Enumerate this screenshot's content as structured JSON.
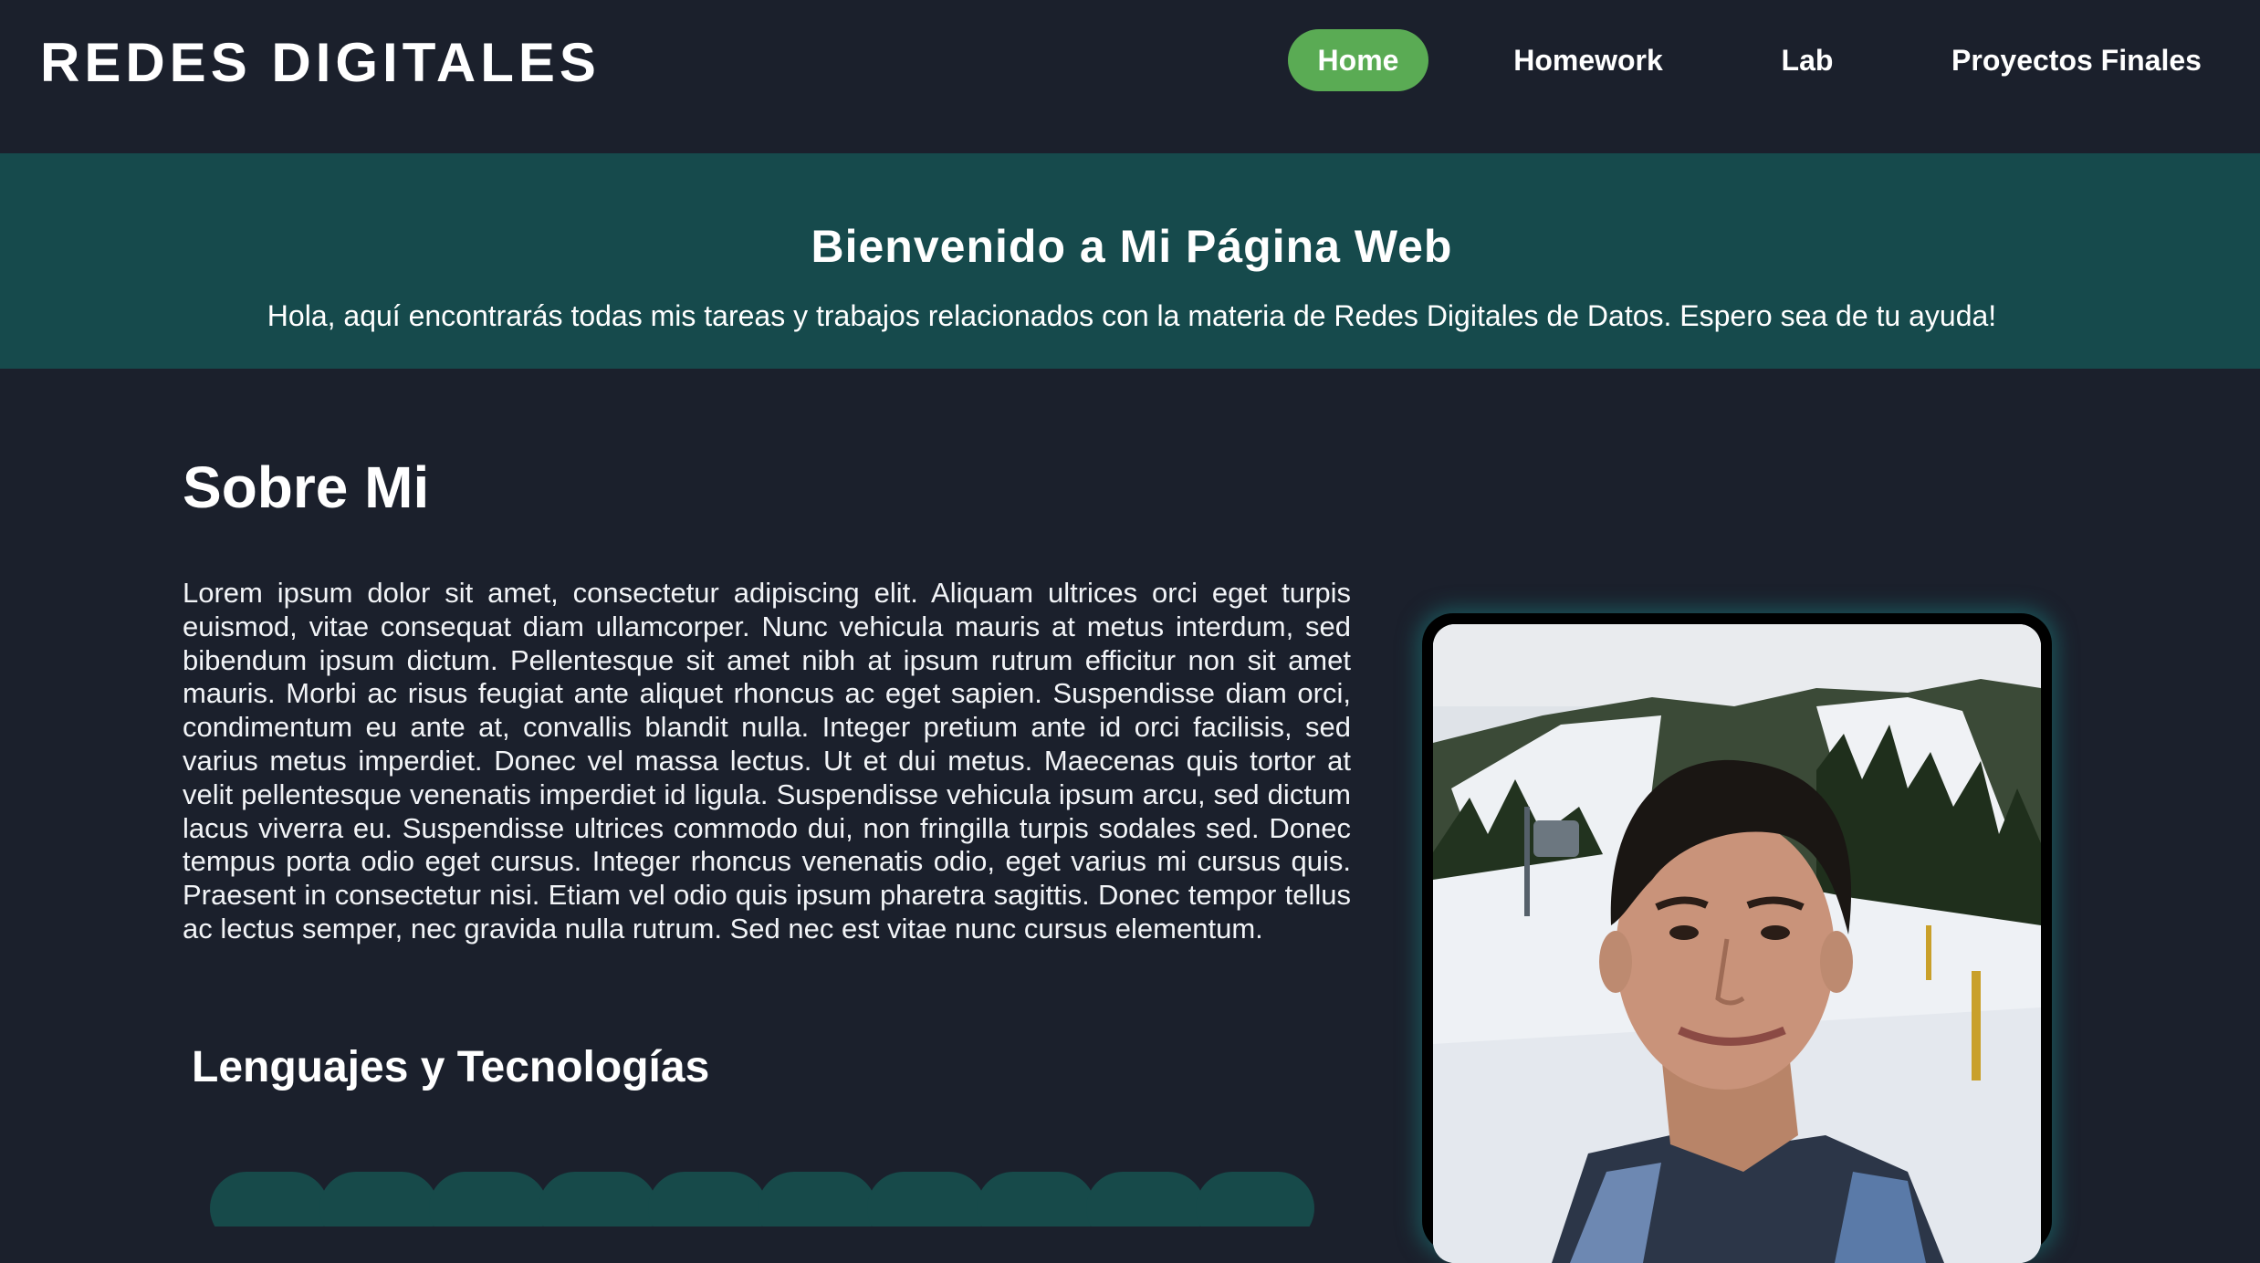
{
  "navbar": {
    "logo": "REDES DIGITALES",
    "links": [
      {
        "label": "Home",
        "active": true
      },
      {
        "label": "Homework",
        "active": false
      },
      {
        "label": "Lab",
        "active": false
      },
      {
        "label": "Proyectos Finales",
        "active": false
      }
    ]
  },
  "hero": {
    "title": "Bienvenido a Mi Página Web",
    "subtitle": "Hola, aquí encontrarás todas mis tareas y trabajos relacionados con la materia de Redes Digitales de Datos. Espero sea de tu ayuda!"
  },
  "about": {
    "title": "Sobre Mi",
    "text": "Lorem ipsum dolor sit amet, consectetur adipiscing elit. Aliquam ultrices orci eget turpis euismod, vitae consequat diam ullamcorper. Nunc vehicula mauris at metus interdum, sed bibendum ipsum dictum. Pellentesque sit amet nibh at ipsum rutrum efficitur non sit amet mauris. Morbi ac risus feugiat ante aliquet rhoncus ac eget sapien. Suspendisse diam orci, condimentum eu ante at, convallis blandit nulla. Integer pretium ante id orci facilisis, sed varius metus imperdiet. Donec vel massa lectus. Ut et dui metus. Maecenas quis tortor at velit pellentesque venenatis imperdiet id ligula. Suspendisse vehicula ipsum arcu, sed dictum lacus viverra eu. Suspendisse ultrices commodo dui, non fringilla turpis sodales sed. Donec tempus porta odio eget cursus. Integer rhoncus venenatis odio, eget varius mi cursus quis. Praesent in consectetur nisi. Etiam vel odio quis ipsum pharetra sagittis. Donec tempor tellus ac lectus semper, nec gravida nulla rutrum. Sed nec est vitae nunc cursus elementum.",
    "tech_title": "Lenguajes y Tecnologías"
  },
  "colors": {
    "page_background": "#1b202c",
    "hero_background": "#164a4c",
    "active_nav": "#5aab54",
    "text": "#ffffff"
  },
  "photo": {
    "subject": "portrait-photo"
  }
}
